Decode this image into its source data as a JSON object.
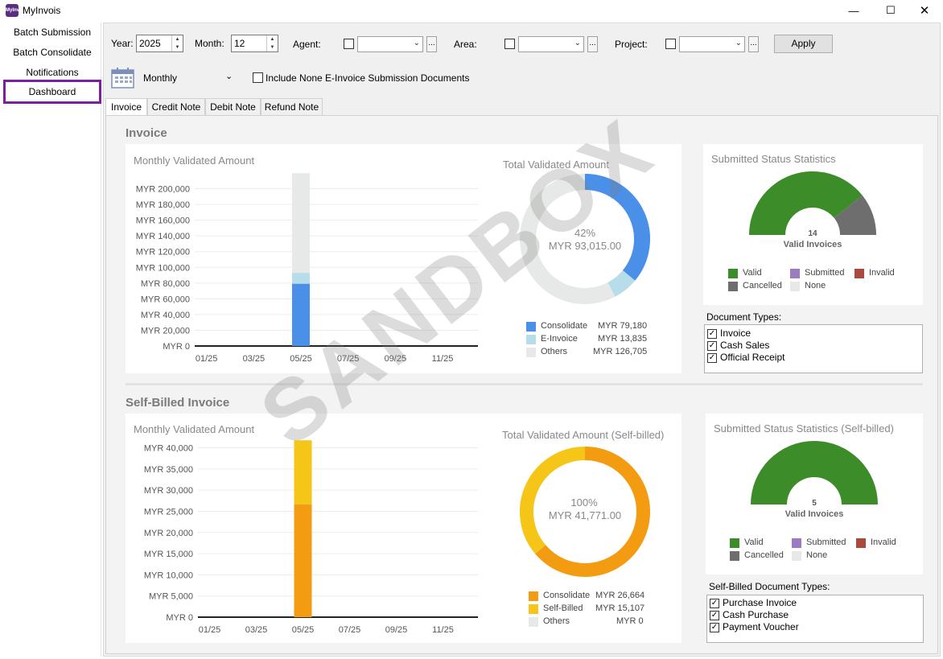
{
  "window": {
    "title": "MyInvois",
    "icon_text": "MyInv"
  },
  "sidebar": {
    "items": [
      {
        "label": "Batch Submission"
      },
      {
        "label": "Batch Consolidate"
      },
      {
        "label": "Notifications"
      },
      {
        "label": "Dashboard"
      }
    ]
  },
  "filters": {
    "year_label": "Year:",
    "year_value": "2025",
    "month_label": "Month:",
    "month_value": "12",
    "agent_label": "Agent:",
    "area_label": "Area:",
    "project_label": "Project:",
    "dots": "...",
    "apply_label": "Apply",
    "period_value": "Monthly",
    "include_none_label": "Include None E-Invoice Submission Documents"
  },
  "tabs": [
    {
      "label": "Invoice"
    },
    {
      "label": "Credit Note"
    },
    {
      "label": "Debit Note"
    },
    {
      "label": "Refund Note"
    }
  ],
  "invoice": {
    "section_title": "Invoice",
    "bar_title": "Monthly Validated Amount",
    "donut_title": "Total Validated Amount",
    "donut_pct": "42%",
    "donut_amount": "MYR 93,015.00",
    "legend": [
      {
        "name": "Consolidate",
        "value": "MYR 79,180",
        "color": "#4a8fe8"
      },
      {
        "name": "E-Invoice",
        "value": "MYR 13,835",
        "color": "#b7dcea"
      },
      {
        "name": "Others",
        "value": "MYR 126,705",
        "color": "#e6e9e7"
      }
    ],
    "status_title": "Submitted Status Statistics",
    "gauge_count": "14",
    "gauge_label": "Valid Invoices",
    "status_legend": [
      {
        "name": "Valid",
        "color": "#3c8c29"
      },
      {
        "name": "Submitted",
        "color": "#9b7cc0"
      },
      {
        "name": "Invalid",
        "color": "#a94a3c"
      },
      {
        "name": "Cancelled",
        "color": "#6e6e6e"
      },
      {
        "name": "None",
        "color": "#e6e9e7"
      }
    ],
    "doctypes_title": "Document Types:",
    "doctypes": [
      {
        "label": "Invoice"
      },
      {
        "label": "Cash Sales"
      },
      {
        "label": "Official Receipt"
      }
    ]
  },
  "selfbilled": {
    "section_title": "Self-Billed Invoice",
    "bar_title": "Monthly Validated Amount",
    "donut_title": "Total Validated Amount (Self-billed)",
    "donut_pct": "100%",
    "donut_amount": "MYR 41,771.00",
    "legend": [
      {
        "name": "Consolidate",
        "value": "MYR 26,664",
        "color": "#f39c12"
      },
      {
        "name": "Self-Billed",
        "value": "MYR 15,107",
        "color": "#f5c518"
      },
      {
        "name": "Others",
        "value": "MYR 0",
        "color": "#e6e9e7"
      }
    ],
    "status_title": "Submitted Status Statistics (Self-billed)",
    "gauge_count": "5",
    "gauge_label": "Valid Invoices",
    "status_legend": [
      {
        "name": "Valid",
        "color": "#3c8c29"
      },
      {
        "name": "Submitted",
        "color": "#9b7cc0"
      },
      {
        "name": "Invalid",
        "color": "#a94a3c"
      },
      {
        "name": "Cancelled",
        "color": "#6e6e6e"
      },
      {
        "name": "None",
        "color": "#e6e9e7"
      }
    ],
    "doctypes_title": "Self-Billed Document Types:",
    "doctypes": [
      {
        "label": "Purchase Invoice"
      },
      {
        "label": "Cash Purchase"
      },
      {
        "label": "Payment Voucher"
      }
    ]
  },
  "watermark": "SANDBOX",
  "chart_data": [
    {
      "type": "bar",
      "title": "Monthly Validated Amount",
      "stacked": true,
      "x_ticks": [
        "01/25",
        "03/25",
        "05/25",
        "07/25",
        "09/25",
        "11/25"
      ],
      "y_ticks": [
        "MYR 0",
        "MYR 20,000",
        "MYR 40,000",
        "MYR 60,000",
        "MYR 80,000",
        "MYR 100,000",
        "MYR 120,000",
        "MYR 140,000",
        "MYR 160,000",
        "MYR 180,000",
        "MYR 200,000"
      ],
      "ylim": [
        0,
        220000
      ],
      "categories": [
        "05/25"
      ],
      "series": [
        {
          "name": "Consolidate",
          "color": "#4a8fe8",
          "values": [
            79180
          ]
        },
        {
          "name": "E-Invoice",
          "color": "#b7dcea",
          "values": [
            13835
          ]
        },
        {
          "name": "Others",
          "color": "#e6e9e7",
          "values": [
            126705
          ]
        }
      ]
    },
    {
      "type": "pie",
      "title": "Total Validated Amount",
      "donut": true,
      "slices": [
        {
          "name": "Consolidate",
          "value": 79180,
          "color": "#4a8fe8"
        },
        {
          "name": "E-Invoice",
          "value": 13835,
          "color": "#b7dcea"
        },
        {
          "name": "Others",
          "value": 126705,
          "color": "#e6e9e7"
        }
      ]
    },
    {
      "type": "pie",
      "title": "Submitted Status Statistics",
      "gauge": true,
      "slices": [
        {
          "name": "Valid",
          "value": 11,
          "color": "#3c8c29"
        },
        {
          "name": "Cancelled",
          "value": 3,
          "color": "#6e6e6e"
        }
      ]
    },
    {
      "type": "bar",
      "title": "Monthly Validated Amount",
      "stacked": true,
      "x_ticks": [
        "01/25",
        "03/25",
        "05/25",
        "07/25",
        "09/25",
        "11/25"
      ],
      "y_ticks": [
        "MYR 0",
        "MYR 5,000",
        "MYR 10,000",
        "MYR 15,000",
        "MYR 20,000",
        "MYR 25,000",
        "MYR 30,000",
        "MYR 35,000",
        "MYR 40,000"
      ],
      "ylim": [
        0,
        42000
      ],
      "categories": [
        "05/25"
      ],
      "series": [
        {
          "name": "Consolidate",
          "color": "#f39c12",
          "values": [
            26664
          ]
        },
        {
          "name": "Self-Billed",
          "color": "#f5c518",
          "values": [
            15107
          ]
        }
      ]
    },
    {
      "type": "pie",
      "title": "Total Validated Amount (Self-billed)",
      "donut": true,
      "slices": [
        {
          "name": "Consolidate",
          "value": 26664,
          "color": "#f39c12"
        },
        {
          "name": "Self-Billed",
          "value": 15107,
          "color": "#f5c518"
        },
        {
          "name": "Others",
          "value": 0,
          "color": "#e6e9e7"
        }
      ]
    },
    {
      "type": "pie",
      "title": "Submitted Status Statistics (Self-billed)",
      "gauge": true,
      "slices": [
        {
          "name": "Valid",
          "value": 5,
          "color": "#3c8c29"
        }
      ]
    }
  ]
}
